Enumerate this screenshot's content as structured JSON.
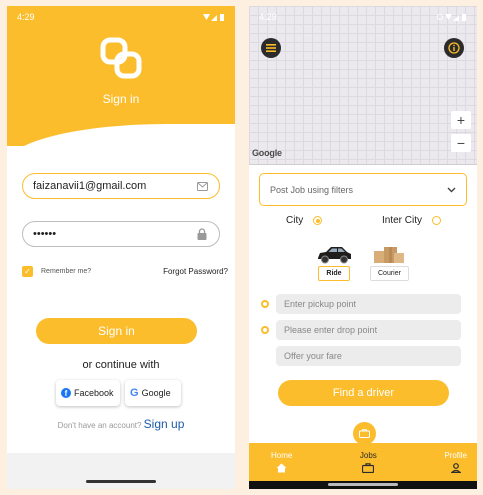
{
  "status_bar": {
    "time": "4:29"
  },
  "signin": {
    "title": "Sign in",
    "email_value": "faizanavii1@gmail.com",
    "password_value": "••••••",
    "remember_label": "Remember me?",
    "forgot_label": "Forgot Password?",
    "signin_button": "Sign in",
    "or_text": "or continue with",
    "facebook_label": "Facebook",
    "google_label": "Google",
    "no_account_text": "Don't have an account?",
    "signup_link": "Sign up"
  },
  "job": {
    "map_watermark": "Google",
    "zoom_in": "+",
    "zoom_out": "−",
    "filter_placeholder": "Post Job using filters",
    "city_label": "City",
    "intercity_label": "Inter City",
    "ride_label": "Ride",
    "courier_label": "Courier",
    "pickup_placeholder": "Enter pickup point",
    "drop_placeholder": "Please enter drop point",
    "fare_placeholder": "Offer your fare",
    "find_button": "Find a driver",
    "nav": {
      "home": "Home",
      "jobs": "Jobs",
      "profile": "Profile"
    }
  },
  "colors": {
    "accent": "#fbbd2b",
    "dark": "#2b2b2b",
    "link": "#1a5ba8"
  },
  "icons": [
    "logo-icon",
    "email-icon",
    "lock-icon",
    "check-icon",
    "facebook-icon",
    "google-icon",
    "menu-icon",
    "info-icon",
    "chevron-down-icon",
    "car-icon",
    "boxes-icon",
    "home-icon",
    "briefcase-icon",
    "user-icon"
  ]
}
